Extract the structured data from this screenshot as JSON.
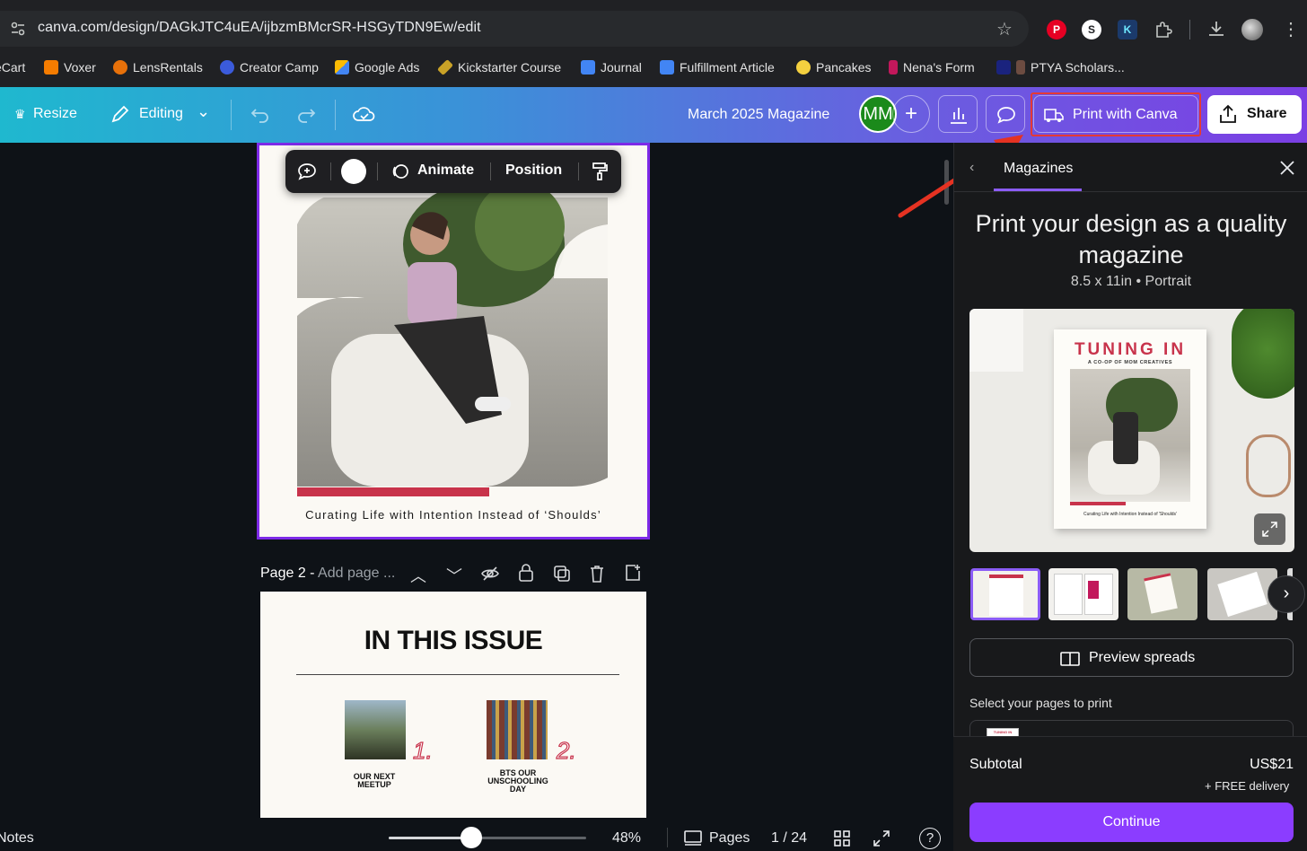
{
  "browser": {
    "url": "canva.com/design/DAGkJTC4uEA/ijbzmBMcrSR-HSGyTDN9Ew/edit",
    "bookmarks": [
      {
        "label": "eCart",
        "icon": "cart-icon",
        "color": "#3cba54"
      },
      {
        "label": "Voxer",
        "icon": "voxer-icon",
        "color": "#f57c00"
      },
      {
        "label": "LensRentals",
        "icon": "lensrentals-icon",
        "color": "#e8710a"
      },
      {
        "label": "Creator Camp",
        "icon": "creator-camp-icon",
        "color": "#3b5bdb"
      },
      {
        "label": "Google Ads",
        "icon": "google-ads-icon",
        "color": "#fbbc04"
      },
      {
        "label": "Kickstarter Course",
        "icon": "pencil-icon",
        "color": "#c9a227"
      },
      {
        "label": "Journal",
        "icon": "docs-icon",
        "color": "#4285f4"
      },
      {
        "label": "Fulfillment Article",
        "icon": "docs-icon",
        "color": "#4285f4"
      },
      {
        "label": "Pancakes",
        "icon": "pancakes-icon",
        "color": "#f4d03f"
      },
      {
        "label": "Nena's Form",
        "icon": "form-icon",
        "color": "#c2185b"
      },
      {
        "label": "PTYA Scholars...",
        "icon": "ptya-icon",
        "color": "#1a237e"
      }
    ]
  },
  "toolbar": {
    "resize_label": "Resize",
    "editing_label": "Editing",
    "doc_title": "March 2025 Magazine",
    "avatar_initials": "MM",
    "print_label": "Print with Canva",
    "share_label": "Share"
  },
  "floatbar": {
    "animate_label": "Animate",
    "position_label": "Position"
  },
  "page1": {
    "caption": "Curating Life with Intention Instead of ‘Shoulds’"
  },
  "page2": {
    "label_prefix": "Page 2 - ",
    "label_placeholder": "Add page ...",
    "heading": "IN THIS ISSUE",
    "items": [
      {
        "number": "1.",
        "caption": "OUR NEXT MEETUP"
      },
      {
        "number": "2.",
        "caption": "BTS OUR UNSCHOOLING DAY"
      }
    ]
  },
  "bottombar": {
    "notes_label": "Notes",
    "zoom": "48%",
    "zoom_fraction": 0.42,
    "pages_label": "Pages",
    "page_counter": "1 / 24"
  },
  "panel": {
    "tab_label": "Magazines",
    "title": "Print your design as a quality magazine",
    "subtitle": "8.5 x 11in • Portrait",
    "mockup_title": "TUNING IN",
    "mockup_subtitle": "A CO-OP OF MOM CREATIVES",
    "mockup_caption": "Curating Life with Intention Instead of 'Shoulds'",
    "preview_label": "Preview spreads",
    "select_label": "Select your pages to print",
    "page_select_value": "TUNING IN",
    "subtotal_label": "Subtotal",
    "subtotal_value": "US$21",
    "delivery_label": "+ FREE delivery",
    "continue_label": "Continue"
  },
  "colors": {
    "accent_purple": "#8b3dff",
    "highlight_red": "#e53935",
    "magazine_red": "#c8334b"
  }
}
